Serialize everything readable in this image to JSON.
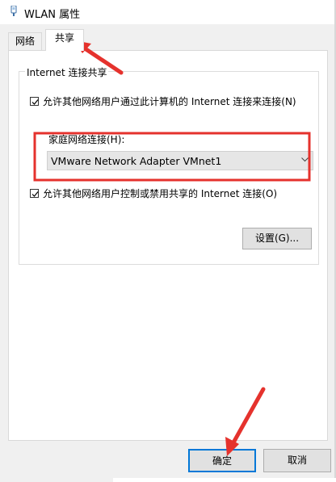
{
  "window": {
    "title": "WLAN 属性",
    "icon": "network-adapter-icon"
  },
  "tabs": [
    {
      "label": "网络",
      "selected": false
    },
    {
      "label": "共享",
      "selected": true
    }
  ],
  "sharing": {
    "group_title": "Internet 连接共享",
    "allow_connect": {
      "label": "允许其他网络用户通过此计算机的 Internet 连接来连接(N)",
      "checked": true
    },
    "home_network_label": "家庭网络连接(H):",
    "home_network_value": "VMware Network Adapter VMnet1",
    "allow_control": {
      "label": "允许其他网络用户控制或禁用共享的 Internet 连接(O)",
      "checked": true
    },
    "settings_button": "设置(G)..."
  },
  "footer": {
    "ok_label": "确定",
    "cancel_label": "取消"
  },
  "annotation_color": "#e5322d"
}
